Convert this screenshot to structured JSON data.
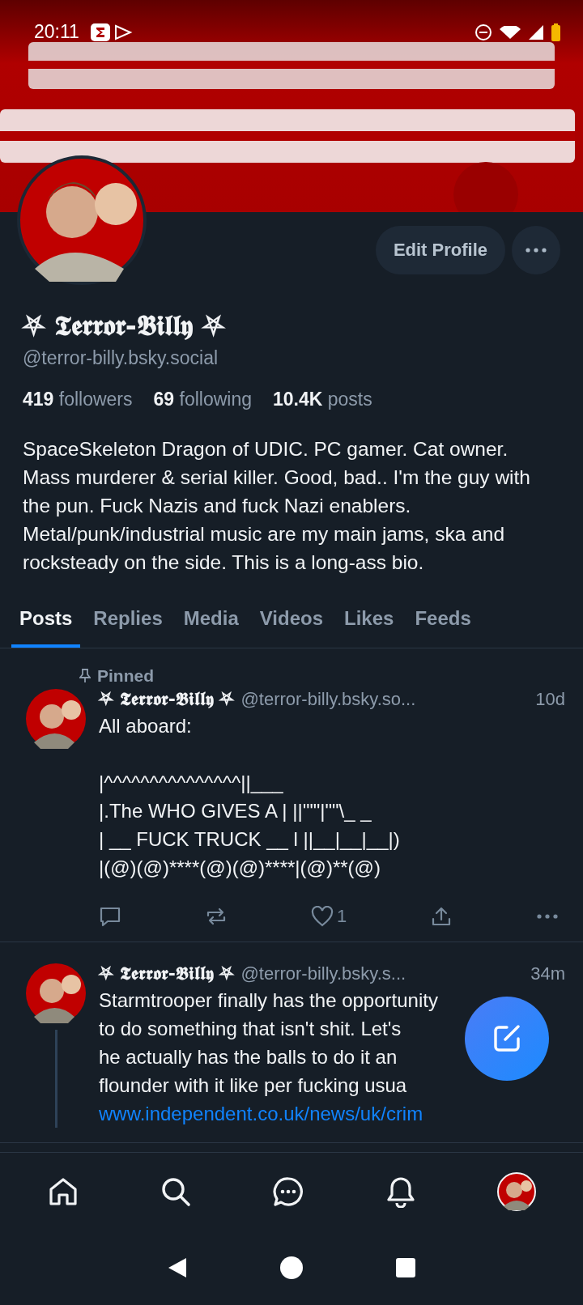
{
  "status_bar": {
    "time": "20:11"
  },
  "profile": {
    "display_name": "⛧ 𝕿𝖊𝖗𝖗𝖔𝖗-𝕭𝖎𝖑𝖑𝖞 ⛧",
    "handle": "@terror-billy.bsky.social",
    "edit_button": "Edit Profile",
    "stats": [
      "**419** followers",
      "**69** following",
      "**10.4K** posts"
    ],
    "bio": "SpaceSkeleton Dragon of UDIC. PC gamer. Cat owner. Mass murderer & serial killer. Good, bad.. I'm the guy with the pun. Fuck Nazis and fuck Nazi enablers. Metal/punk/industrial music are my main jams, ska and rocksteady on the side. This is a long-ass bio."
  },
  "tabs": [
    {
      "label": "Posts",
      "selected": true
    },
    {
      "label": "Replies",
      "selected": false
    },
    {
      "label": "Media",
      "selected": false
    },
    {
      "label": "Videos",
      "selected": false
    },
    {
      "label": "Likes",
      "selected": false
    },
    {
      "label": "Feeds",
      "selected": false
    }
  ],
  "posts": [
    {
      "pinned_label": "Pinned",
      "display_name": "⛧ 𝕿𝖊𝖗𝖗𝖔𝖗-𝕭𝖎𝖑𝖑𝖞 ⛧",
      "handle": "@terror-billy.bsky.so...",
      "time": "10d",
      "thread": false,
      "paragraphs": [
        [
          "All aboard:"
        ],
        [
          "|^^^^^^^^^^^^^^^||___",
          "|.The WHO GIVES A | ||'\"\"|\"\"\\_ _",
          "| __ FUCK TRUCK __ l ||__|__|__|)",
          "|(@)(@)****(@)(@)****|(@)**(@)"
        ]
      ],
      "like_count": "1"
    },
    {
      "display_name": "⛧ 𝕿𝖊𝖗𝖗𝖔𝖗-𝕭𝖎𝖑𝖑𝖞 ⛧",
      "handle": "@terror-billy.bsky.s...",
      "time": "34m",
      "thread": true,
      "paragraphs": [
        [
          "Starmtrooper finally has the opportunity",
          "to do something that isn't shit. Let's",
          "he actually has the balls to do it an",
          "flounder with it like per fucking usua"
        ]
      ],
      "link": "www.independent.co.uk/news/uk/crim"
    }
  ],
  "nav": [
    {
      "kind": "home"
    },
    {
      "kind": "search"
    },
    {
      "kind": "chat"
    },
    {
      "kind": "bell"
    },
    {
      "kind": "avatar"
    }
  ]
}
